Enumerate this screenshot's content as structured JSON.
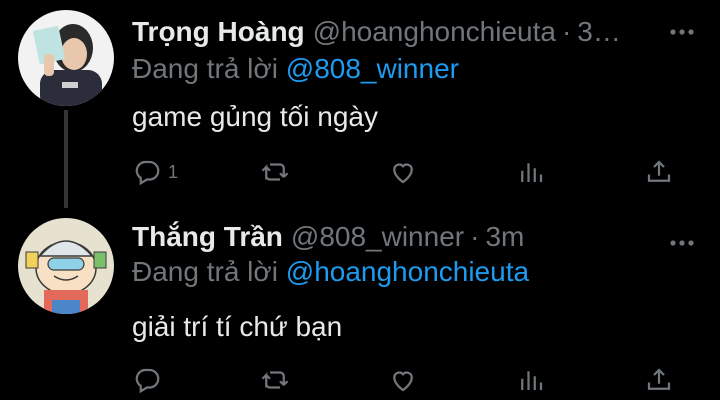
{
  "tweets": [
    {
      "name": "Trọng Hoàng",
      "handle": "@hoanghonchieuta",
      "time_truncated": "3…",
      "reply_prefix": "Đang trả lời",
      "reply_mention": "@808_winner",
      "text": "game gủng tối ngày",
      "reply_count": "1",
      "avatar_icon": "person-photo-avatar"
    },
    {
      "name": "Thắng Trần",
      "handle": "@808_winner",
      "time": "3m",
      "reply_prefix": "Đang trả lời",
      "reply_mention": "@hoanghonchieuta",
      "text": "giải trí tí chứ bạn",
      "reply_count": "",
      "avatar_icon": "cartoon-character-avatar"
    }
  ],
  "icons": [
    "reply-icon",
    "retweet-icon",
    "like-icon",
    "stats-icon",
    "share-icon",
    "more-icon"
  ],
  "colors": {
    "background": "#000000",
    "primary_text": "#e7e9ea",
    "secondary_text": "#71767b",
    "accent": "#1d9bf0",
    "thread_line": "#333639"
  }
}
